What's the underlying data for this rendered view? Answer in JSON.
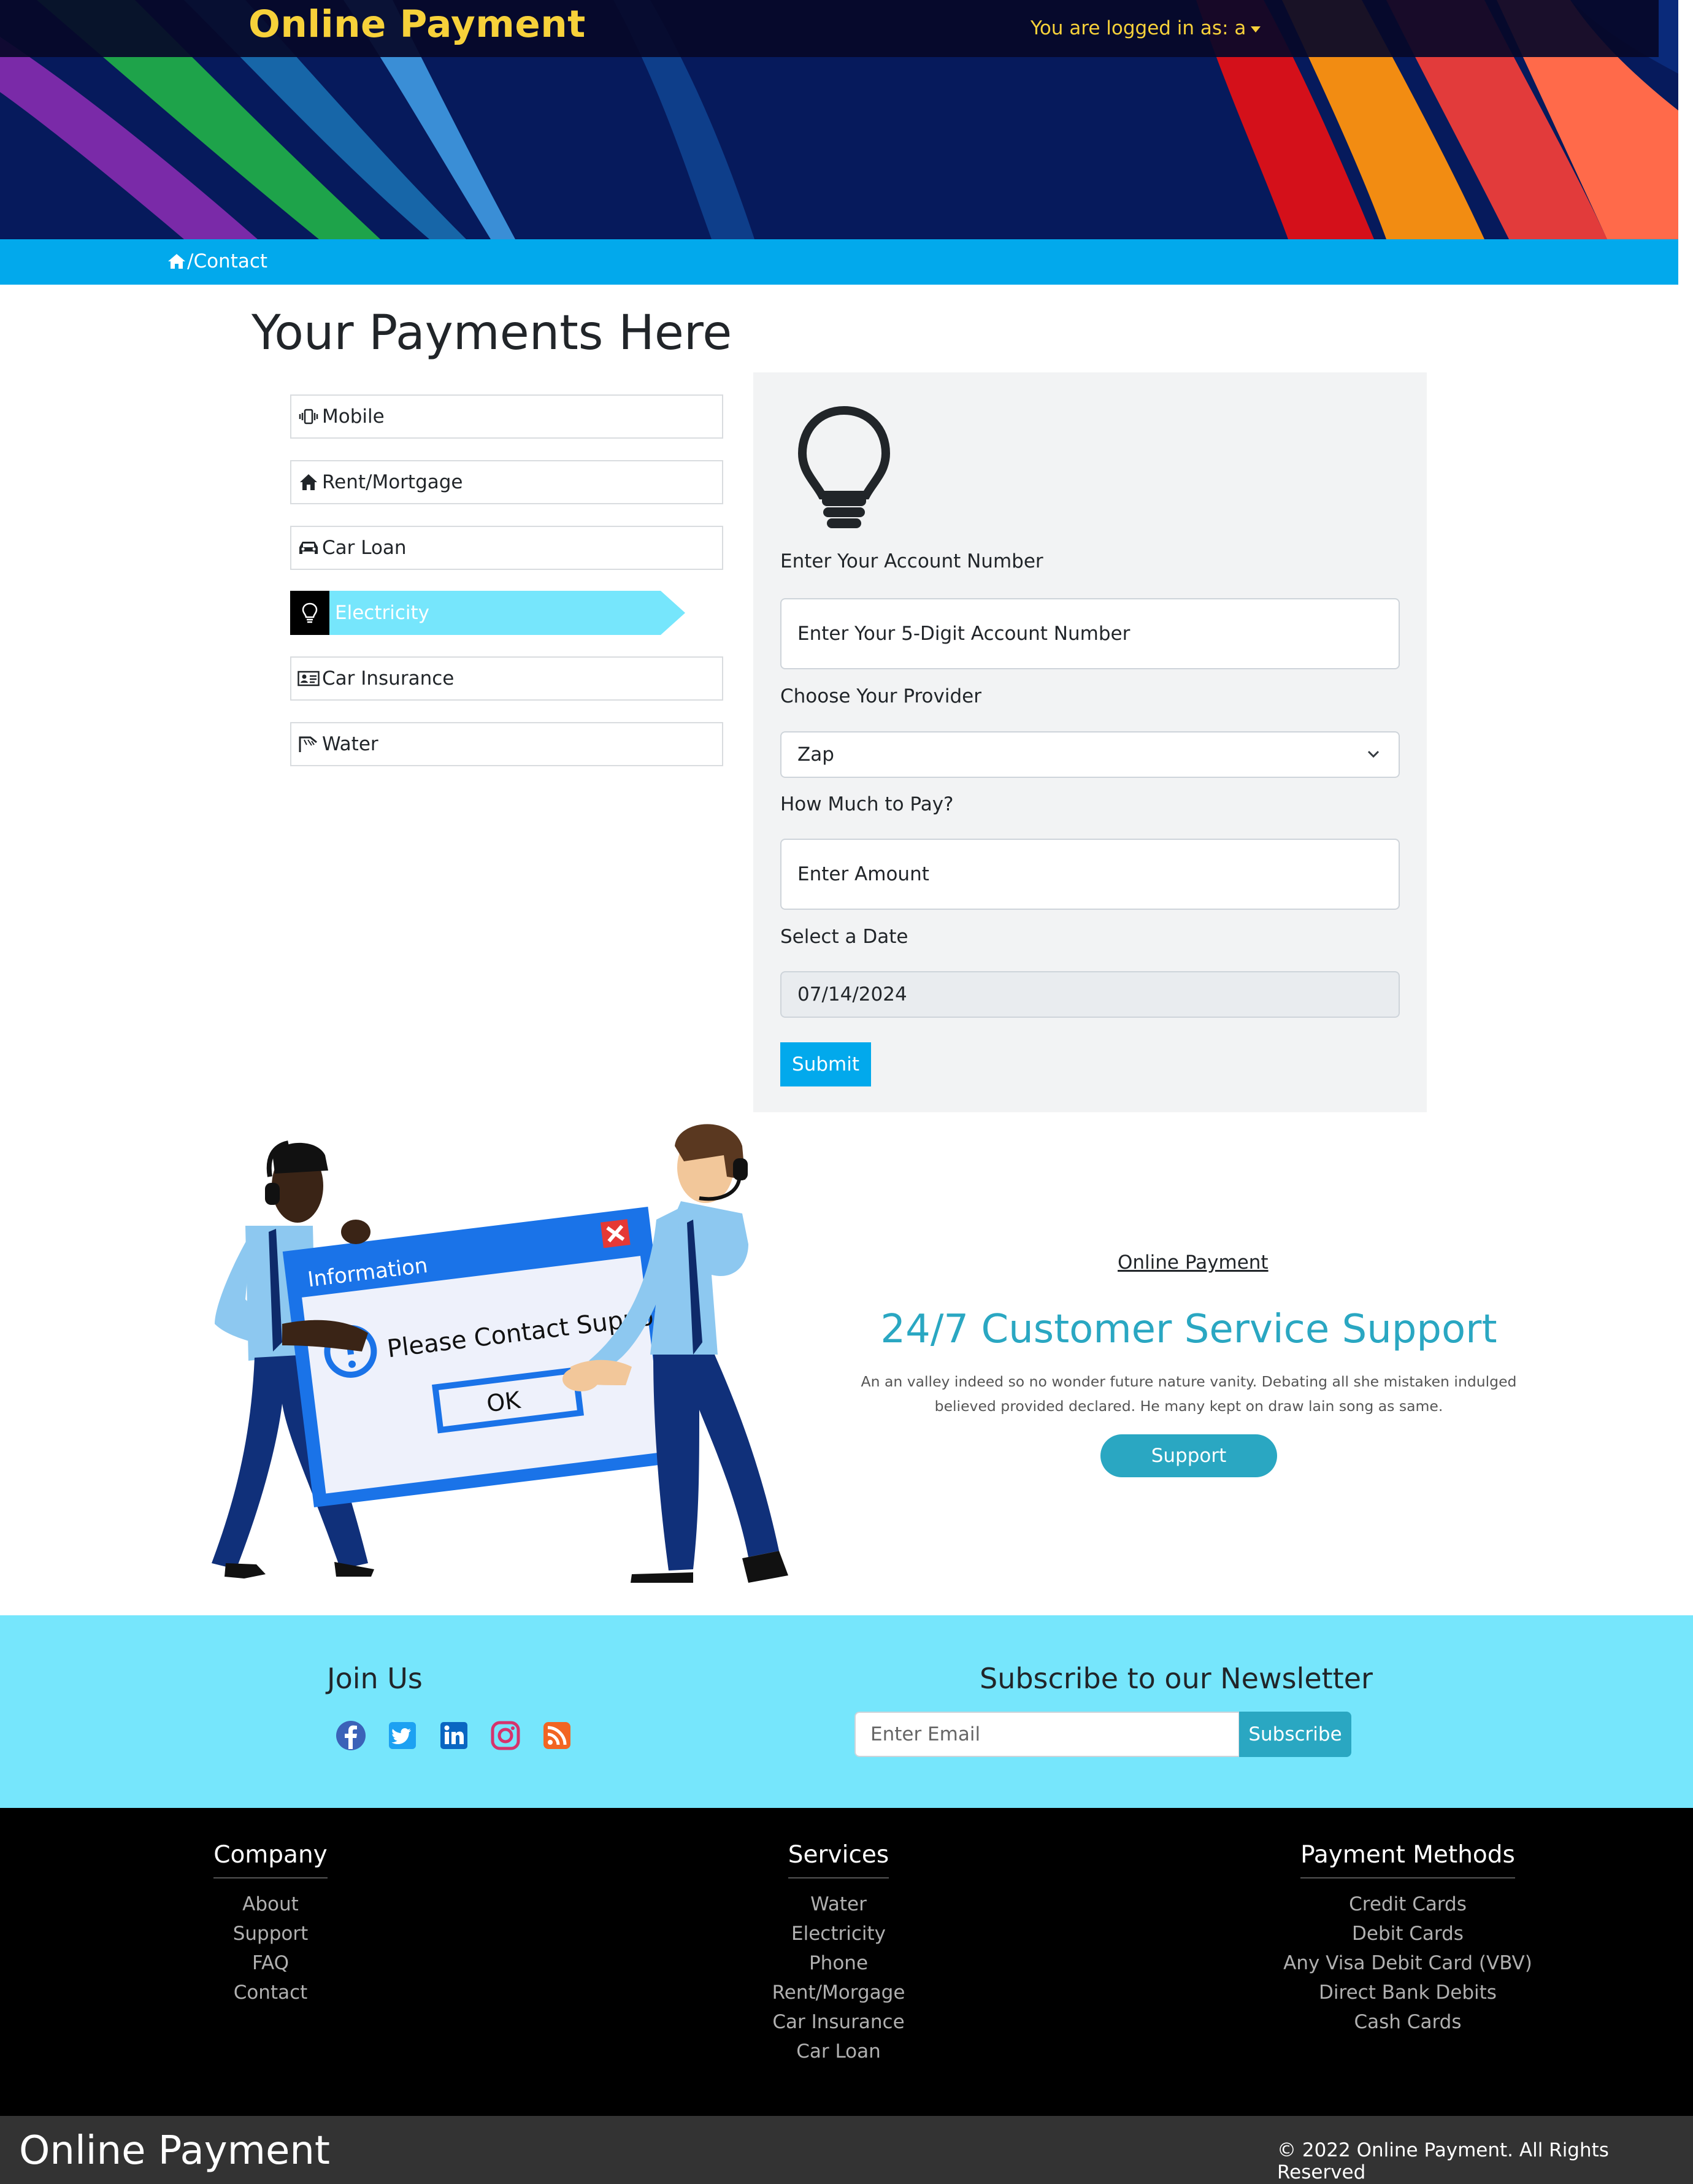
{
  "header": {
    "brand": "Online Payment",
    "user_menu": "You are logged in as: a"
  },
  "breadcrumb": {
    "current": "/Contact"
  },
  "payments": {
    "title": "Your Payments Here",
    "items": [
      {
        "label": "Mobile",
        "icon": "mobile-vibrate-icon"
      },
      {
        "label": "Rent/Mortgage",
        "icon": "house-icon"
      },
      {
        "label": "Car Loan",
        "icon": "car-icon"
      },
      {
        "label": "Electricity",
        "icon": "lightbulb-icon",
        "active": true
      },
      {
        "label": "Car Insurance",
        "icon": "id-card-icon"
      },
      {
        "label": "Water",
        "icon": "faucet-icon"
      }
    ],
    "active_color": "#76e6fc"
  },
  "form": {
    "account_label": "Enter Your Account Number",
    "account_placeholder": "Enter Your 5-Digit Account Number",
    "provider_label": "Choose Your Provider",
    "provider_value": "Zap",
    "amount_label": "How Much to Pay?",
    "amount_placeholder": "Enter Amount",
    "date_label": "Select a Date",
    "date_value": "07/14/2024",
    "submit_label": "Submit"
  },
  "illustration": {
    "window_title": "Information",
    "message": "Please Contact Support",
    "ok": "OK"
  },
  "support": {
    "brand": "Online Payment",
    "title": "24/7 Customer Service Support",
    "text": "An an valley indeed so no wonder future nature vanity. Debating all she mistaken indulged believed provided declared. He many kept on draw lain song as same.",
    "button": "Support"
  },
  "join": {
    "title": "Join Us",
    "social": [
      "facebook-icon",
      "twitter-icon",
      "linkedin-icon",
      "instagram-icon",
      "rss-icon"
    ]
  },
  "newsletter": {
    "title": "Subscribe to our Newsletter",
    "email_placeholder": "Enter Email",
    "button": "Subscribe"
  },
  "footer": {
    "columns": [
      {
        "title": "Company",
        "links": [
          "About",
          "Support",
          "FAQ",
          "Contact"
        ]
      },
      {
        "title": "Services",
        "links": [
          "Water",
          "Electricity",
          "Phone",
          "Rent/Morgage",
          "Car Insurance",
          "Car Loan"
        ]
      },
      {
        "title": "Payment Methods",
        "links": [
          "Credit Cards",
          "Debit Cards",
          "Any Visa Debit Card (VBV)",
          "Direct Bank Debits",
          "Cash Cards"
        ]
      }
    ],
    "brand": "Online Payment",
    "copyright": "© 2022 Online Payment. All Rights Reserved"
  },
  "colors": {
    "brand_yellow": "#f7d13a",
    "breadcrumb_blue": "#02a9ec",
    "accent_teal": "#2aa7c2",
    "join_band": "#76e6fc"
  }
}
